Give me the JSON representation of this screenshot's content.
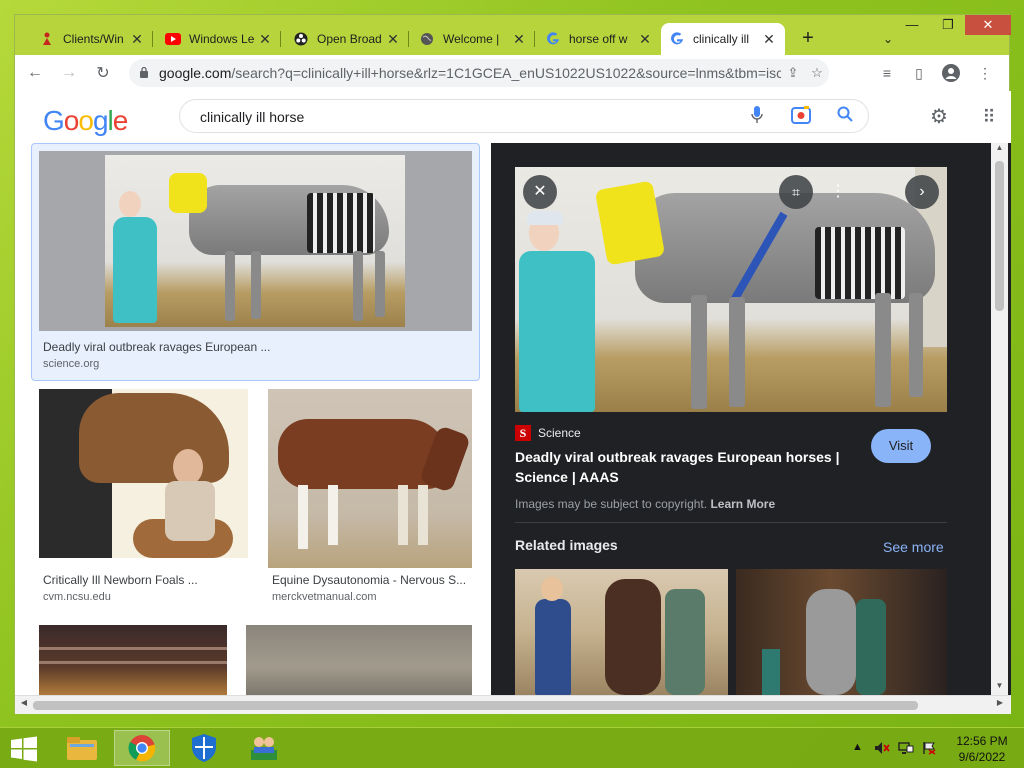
{
  "browser": {
    "tabs": [
      {
        "title": "Clients/Win",
        "favicon": "red-figure-icon"
      },
      {
        "title": "Windows Le",
        "favicon": "youtube-icon"
      },
      {
        "title": "Open Broad",
        "favicon": "obs-icon"
      },
      {
        "title": "Welcome |",
        "favicon": "globe-icon"
      },
      {
        "title": "horse off w",
        "favicon": "google-icon"
      },
      {
        "title": "clinically ill",
        "favicon": "google-icon",
        "active": true
      }
    ],
    "url_host": "google.com",
    "url_rest": "/search?q=clinically+ill+horse&rlz=1C1GCEA_enUS1022US1022&source=lnms&tbm=isc..."
  },
  "google": {
    "logo": [
      "G",
      "o",
      "o",
      "g",
      "l",
      "e"
    ],
    "query": "clinically ill horse"
  },
  "results": [
    {
      "caption": "Deadly viral outbreak ravages European ...",
      "source": "science.org"
    },
    {
      "caption": "Critically Ill Newborn Foals ...",
      "source": "cvm.ncsu.edu"
    },
    {
      "caption": "Equine Dysautonomia - Nervous S...",
      "source": "merckvetmanual.com"
    }
  ],
  "preview": {
    "source_letter": "S",
    "source_name": "Science",
    "title": "Deadly viral outbreak ravages European horses | Science | AAAS",
    "visit_label": "Visit",
    "copyright_text": "Images may be subject to copyright.",
    "learn_more": "Learn More",
    "related_label": "Related images",
    "see_more": "See more"
  },
  "taskbar": {
    "time": "12:56 PM",
    "date": "9/6/2022"
  },
  "colors": {
    "accent_blue": "#8ab4f8",
    "preview_bg": "#202124",
    "tab_strip": "#b8d43c"
  }
}
